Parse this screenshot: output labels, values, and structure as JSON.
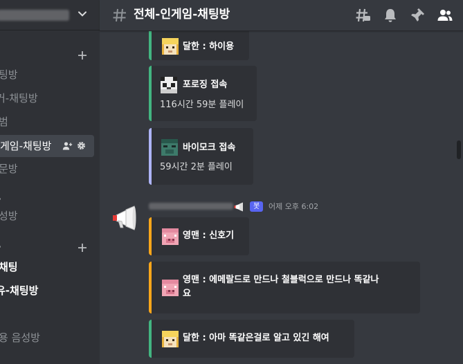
{
  "server": {
    "name_redacted": true,
    "chevron_icon": "chevron-down-icon"
  },
  "sidebar": {
    "channels": [
      {
        "label": "팅방",
        "style": "muted"
      },
      {
        "label": "커-채팅방",
        "style": "muted"
      },
      {
        "label": "범",
        "style": "muted"
      },
      {
        "label": "게임-채팅방",
        "style": "selected"
      },
      {
        "label": "문방",
        "style": "muted"
      },
      {
        "label": "성방",
        "style": "muted"
      },
      {
        "label": "채팅",
        "style": "bold"
      },
      {
        "label": "유-채팅방",
        "style": "bold"
      },
      {
        "label": "용 음성방",
        "style": "muted"
      }
    ],
    "icons": {
      "add": "plus-icon",
      "invite": "add-member-icon",
      "settings": "gear-icon"
    }
  },
  "header": {
    "channel_name": "전체-인게임-채팅방",
    "icons": [
      "threads-icon",
      "bell-icon",
      "pin-icon",
      "members-icon"
    ]
  },
  "messages": {
    "cards_top": [
      {
        "title": "달한 : 하이용",
        "desc": "",
        "accent": "#43b581",
        "avatar": "steve-head-gold-icon"
      },
      {
        "title": "포로징 접속",
        "desc": "116시간 59분 플레이",
        "accent": "#43b581",
        "avatar": "panda-head-icon"
      },
      {
        "title": "바이모크 접속",
        "desc": "59시간 2분 플레이",
        "accent": "#aeb4f7",
        "avatar": "zombie-head-icon"
      }
    ],
    "bot_message": {
      "name_redacted": true,
      "badge": "봇",
      "timestamp": "어제 오후 6:02",
      "avatar": "megaphone-icon"
    },
    "cards_bottom": [
      {
        "title": "영맨 : 신호기",
        "line2": "",
        "accent": "#faa61a",
        "avatar": "pig-head-icon"
      },
      {
        "title": "영맨 : 에메랄드로 만드나 철블럭으로 만드나 똑같나",
        "line2": "요",
        "accent": "#faa61a",
        "avatar": "pig-head-icon"
      },
      {
        "title": "달한 : 아마 똑같은걸로 알고 있긴 해여",
        "line2": "",
        "accent": "#43b581",
        "avatar": "steve-head-gold-icon"
      }
    ]
  },
  "colors": {
    "background": "#36393f",
    "sidebar": "#2f3136",
    "card": "#2f3136",
    "accent_green": "#43b581",
    "accent_orange": "#faa61a",
    "accent_purple": "#aeb4f7",
    "bot_badge": "#5865f2"
  }
}
